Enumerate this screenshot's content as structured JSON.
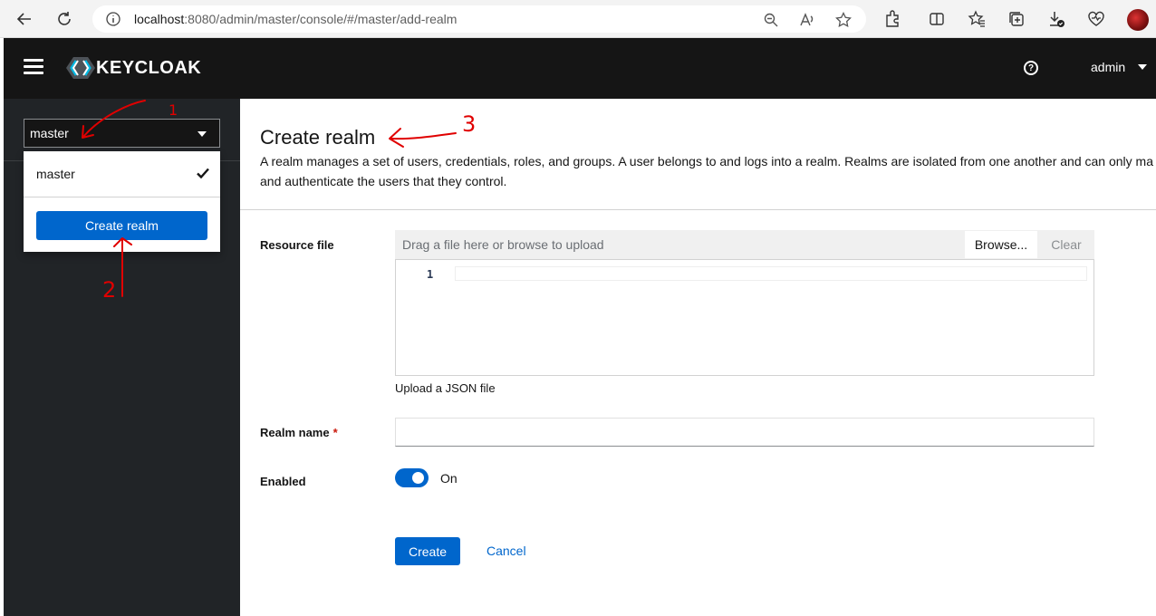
{
  "browser": {
    "url_host": "localhost",
    "url_path": ":8080/admin/master/console/#/master/add-realm",
    "icons": [
      "back-icon",
      "refresh-icon",
      "info-icon",
      "zoom-out-icon",
      "read-aloud-icon",
      "favorite-star-icon",
      "extensions-icon",
      "split-screen-icon",
      "favorites-icon",
      "collections-icon",
      "downloads-icon",
      "browser-essentials-icon",
      "profile-avatar"
    ]
  },
  "header": {
    "logo_text": "KEYCLOAK",
    "help_icon": "?",
    "user": "admin"
  },
  "sidebar": {
    "realm_selected": "master",
    "realm_options": [
      {
        "label": "master",
        "checked": true
      }
    ],
    "create_realm_label": "Create realm"
  },
  "main": {
    "title": "Create realm",
    "description_line1": "A realm manages a set of users, credentials, roles, and groups. A user belongs to and logs into a realm. Realms are isolated from one another and can only ma",
    "description_line2": "and authenticate the users that they control.",
    "resource_file": {
      "label": "Resource file",
      "placeholder": "Drag a file here or browse to upload",
      "browse_label": "Browse...",
      "clear_label": "Clear",
      "line_number": "1",
      "helper": "Upload a JSON file"
    },
    "realm_name": {
      "label": "Realm name",
      "required_mark": "*",
      "value": ""
    },
    "enabled": {
      "label": "Enabled",
      "state_label": "On",
      "on": true
    },
    "create_label": "Create",
    "cancel_label": "Cancel"
  },
  "annotations": {
    "marks": [
      "1",
      "2",
      "3"
    ],
    "color": "#e00000"
  },
  "colors": {
    "primary": "#0066cc",
    "header_bg": "#151515",
    "sidebar_bg": "#212427"
  }
}
